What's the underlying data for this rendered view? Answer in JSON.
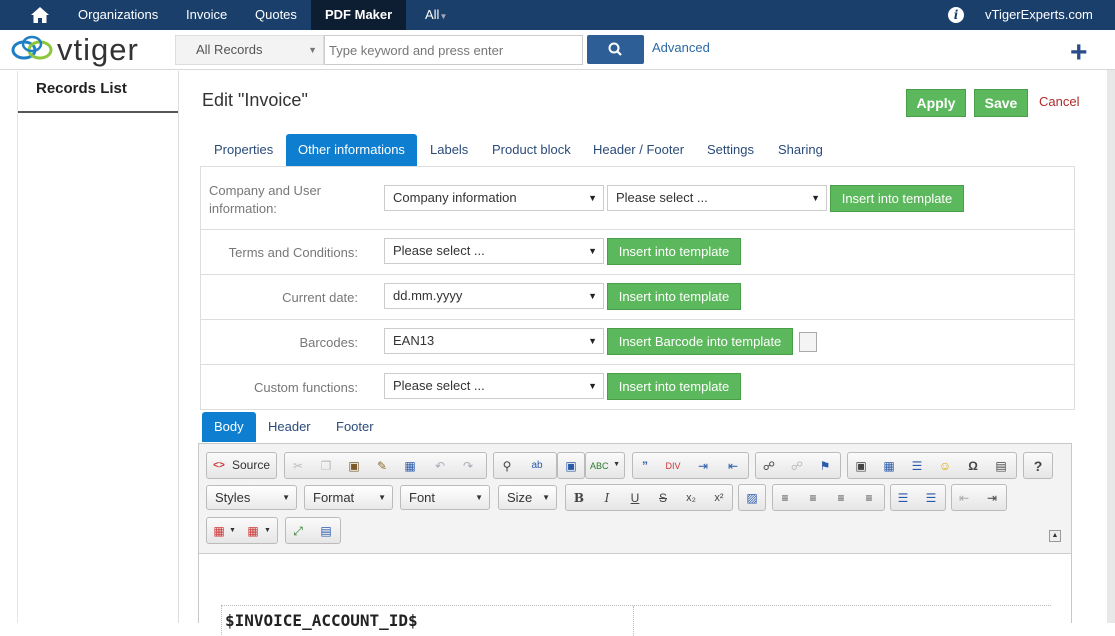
{
  "topbar": {
    "items": [
      "Organizations",
      "Invoice",
      "Quotes",
      "PDF Maker",
      "All"
    ],
    "active_item": "PDF Maker",
    "user": "vTigerExperts.com"
  },
  "brand": {
    "logo_text": "vtiger",
    "accent": "#1b3f6b"
  },
  "search": {
    "scope": "All Records",
    "placeholder": "Type keyword and press enter",
    "advanced": "Advanced"
  },
  "sidebar": {
    "title": "Records List"
  },
  "page": {
    "title": "Edit \"Invoice\"",
    "apply": "Apply",
    "save": "Save",
    "cancel": "Cancel"
  },
  "tabs": [
    "Properties",
    "Other informations",
    "Labels",
    "Product block",
    "Header / Footer",
    "Settings",
    "Sharing"
  ],
  "active_tab": "Other informations",
  "form": {
    "company": {
      "label": "Company and User information:",
      "select1": "Company information",
      "select2": "Please select ...",
      "button": "Insert into template"
    },
    "terms": {
      "label": "Terms and Conditions:",
      "select": "Please select ...",
      "button": "Insert into template"
    },
    "date": {
      "label": "Current date:",
      "select": "dd.mm.yyyy",
      "button": "Insert into template"
    },
    "barcodes": {
      "label": "Barcodes:",
      "select": "EAN13",
      "button": "Insert Barcode into template"
    },
    "custom": {
      "label": "Custom functions:",
      "select": "Please select ...",
      "button": "Insert into template"
    }
  },
  "editor_tabs": [
    "Body",
    "Header",
    "Footer"
  ],
  "active_editor_tab": "Body",
  "toolbar": {
    "source": "Source",
    "styles": "Styles",
    "format": "Format",
    "font": "Font",
    "size": "Size"
  },
  "document": {
    "variable": "$INVOICE_ACCOUNT_ID$"
  }
}
